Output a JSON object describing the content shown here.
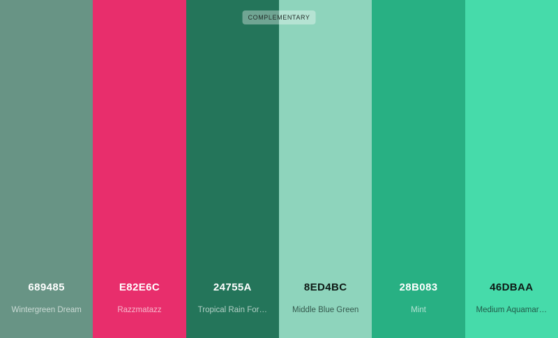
{
  "palette": {
    "badge": "COMPLEMENTARY",
    "swatches": [
      {
        "hex": "689485",
        "name": "Wintergreen Dream",
        "color": "#689485",
        "text": "light"
      },
      {
        "hex": "E82E6C",
        "name": "Razzmatazz",
        "color": "#E82E6C",
        "text": "light"
      },
      {
        "hex": "24755A",
        "name": "Tropical Rain For…",
        "color": "#24755A",
        "text": "light"
      },
      {
        "hex": "8ED4BC",
        "name": "Middle Blue Green",
        "color": "#8ED4BC",
        "text": "dark"
      },
      {
        "hex": "28B083",
        "name": "Mint",
        "color": "#28B083",
        "text": "light"
      },
      {
        "hex": "46DBAA",
        "name": "Medium Aquamar…",
        "color": "#46DBAA",
        "text": "dark"
      }
    ]
  }
}
